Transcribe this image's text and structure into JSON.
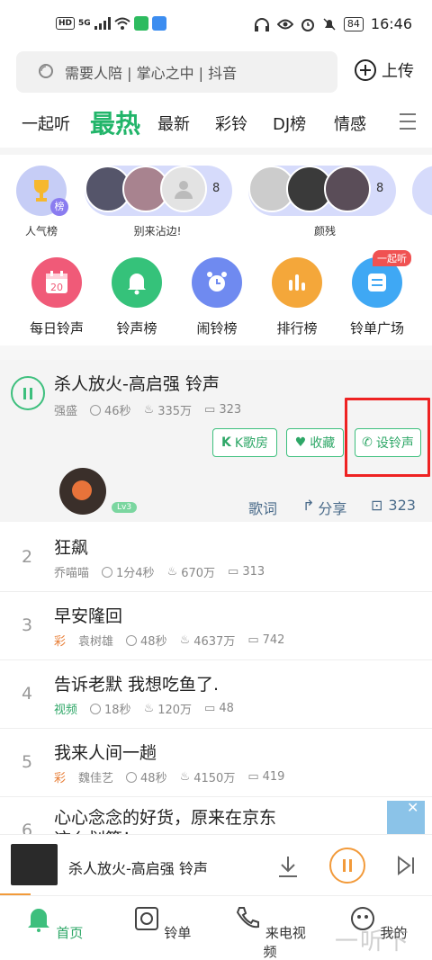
{
  "status": {
    "time": "16:46",
    "battery": "84",
    "left_hd": "HD",
    "left_5g": "5G"
  },
  "search": {
    "placeholder": "需要人陪 | 掌心之中 | 抖音"
  },
  "upload": {
    "label": "上传"
  },
  "tabs": [
    {
      "label": "一起听"
    },
    {
      "label": "最热",
      "active": true
    },
    {
      "label": "最新"
    },
    {
      "label": "彩铃"
    },
    {
      "label": "DJ榜"
    },
    {
      "label": "情感"
    }
  ],
  "avatars": {
    "first_label": "人气榜",
    "first_badge": "榜",
    "group1": {
      "label": "别来沾边!",
      "count": "8"
    },
    "group2": {
      "label": "颜残",
      "count": "8"
    }
  },
  "categories": [
    {
      "label": "每日铃声",
      "icon": "calendar-icon",
      "number": "20",
      "color": "#f05a78"
    },
    {
      "label": "铃声榜",
      "icon": "bell-icon",
      "color": "#35c27a"
    },
    {
      "label": "闹铃榜",
      "icon": "alarm-icon",
      "color": "#6f8af0"
    },
    {
      "label": "排行榜",
      "icon": "chart-bar-icon",
      "color": "#f4a73a"
    },
    {
      "label": "铃单广场",
      "icon": "list-icon",
      "color": "#3fa8f4",
      "badge": "一起听"
    }
  ],
  "playing": {
    "title": "杀人放火-高启强 铃声",
    "artist": "强盛",
    "duration": "46秒",
    "plays": "335万",
    "comments": "323",
    "k_label": "K歌房",
    "fav_label": "收藏",
    "set_label": "设铃声",
    "level": "Lv3",
    "lyrics": "歌词",
    "share": "分享",
    "comment_count": "323"
  },
  "songs": [
    {
      "num": "2",
      "title": "狂飙",
      "tag": "",
      "artist": "乔喵喵",
      "duration": "1分4秒",
      "plays": "670万",
      "comments": "313"
    },
    {
      "num": "3",
      "title": "早安隆回",
      "tag": "彩",
      "artist": "袁树雄",
      "duration": "48秒",
      "plays": "4637万",
      "comments": "742"
    },
    {
      "num": "4",
      "title": "告诉老默 我想吃鱼了.",
      "tag": "视频",
      "artist": "",
      "duration": "18秒",
      "plays": "120万",
      "comments": "48"
    },
    {
      "num": "5",
      "title": "我来人间一趟",
      "tag": "彩",
      "artist": "魏佳艺",
      "duration": "48秒",
      "plays": "4150万",
      "comments": "419"
    }
  ],
  "ad": {
    "text": "心心念念的好货，原来在京东",
    "text2": "这么划算！",
    "num": "6"
  },
  "bottom_player": {
    "title": "杀人放火-高启强 铃声"
  },
  "nav": [
    {
      "label": "首页",
      "icon": "home-bell-icon",
      "active": true
    },
    {
      "label": "铃单",
      "icon": "disc-icon"
    },
    {
      "label": "来电视频",
      "icon": "phone-video-icon"
    },
    {
      "label": "我的",
      "icon": "profile-icon"
    }
  ],
  "watermark": "一听下载"
}
